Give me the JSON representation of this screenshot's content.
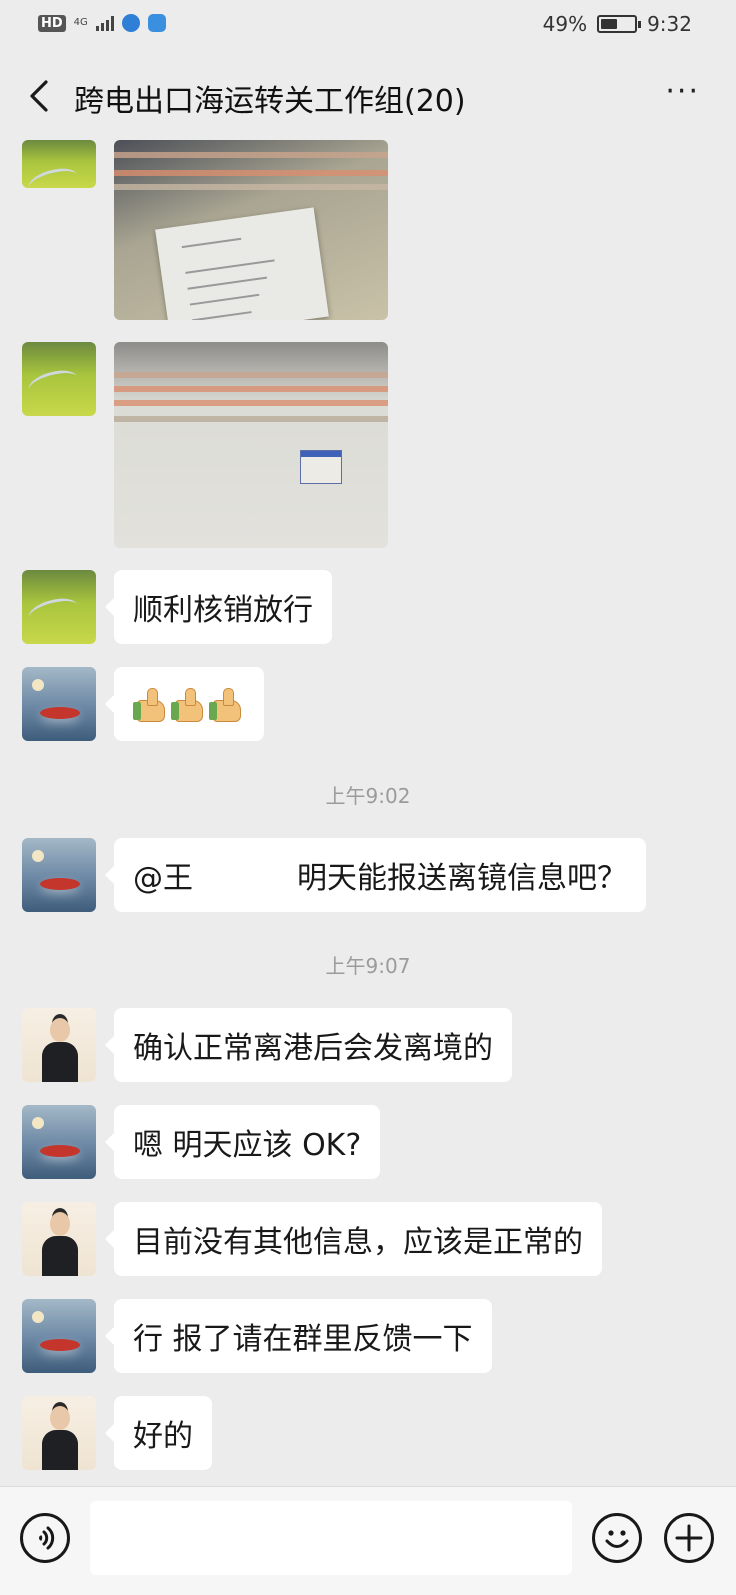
{
  "status_bar": {
    "hd": "HD",
    "network": "4G",
    "battery_text": "49%",
    "battery_level": 0.49,
    "time": "9:32"
  },
  "nav": {
    "title": "跨电出口海运转关工作组(20)",
    "more": "···"
  },
  "messages": [
    {
      "type": "image",
      "avatar": "field",
      "image_desc": "screenshot-photo"
    },
    {
      "type": "image",
      "avatar": "field",
      "image_desc": "screenshot-photo"
    },
    {
      "type": "text",
      "avatar": "field",
      "text": "顺利核销放行"
    },
    {
      "type": "emoji",
      "avatar": "sky",
      "emoji": [
        "thumbs-up",
        "thumbs-up",
        "thumbs-up"
      ]
    },
    {
      "type": "time",
      "text": "上午9:02"
    },
    {
      "type": "text",
      "avatar": "sky",
      "mention": "@王",
      "text": "明天能报送离镜信息吧？"
    },
    {
      "type": "time",
      "text": "上午9:07"
    },
    {
      "type": "text",
      "avatar": "man",
      "text": "确认正常离港后会发离境的"
    },
    {
      "type": "text",
      "avatar": "sky",
      "text": "嗯 明天应该 OK?"
    },
    {
      "type": "text",
      "avatar": "man",
      "text": "目前没有其他信息，应该是正常的"
    },
    {
      "type": "text",
      "avatar": "sky",
      "text": "行 报了请在群里反馈一下"
    },
    {
      "type": "text",
      "avatar": "man",
      "text": "好的"
    }
  ],
  "input_bar": {
    "value": "",
    "voice_icon": "voice-icon",
    "emoji_icon": "emoji-icon",
    "plus_icon": "plus-icon"
  }
}
